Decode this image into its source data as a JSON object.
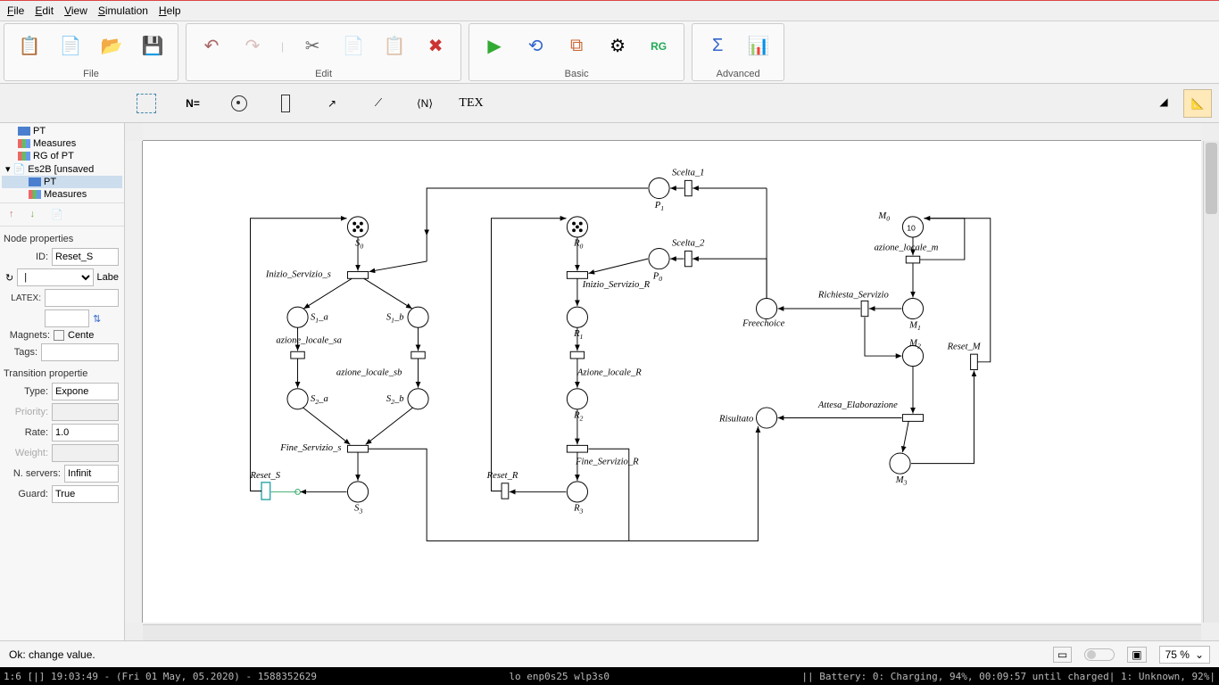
{
  "menubar": {
    "file": "File",
    "edit": "Edit",
    "view": "View",
    "simulation": "Simulation",
    "help": "Help"
  },
  "toolbar_groups": {
    "file": "File",
    "edit": "Edit",
    "basic": "Basic",
    "advanced": "Advanced"
  },
  "toolbar2": {
    "n_eq": "N=",
    "angle_n": "⟨N⟩",
    "tex": "TEX"
  },
  "tree": {
    "pt": "PT",
    "measures": "Measures",
    "rg_of_pt": "RG of PT",
    "es2b": "Es2B [unsaved",
    "sub_pt": "PT",
    "sub_measures": "Measures"
  },
  "props": {
    "node_props": "Node properties",
    "id_label": "ID:",
    "id_value": "Reset_S",
    "rot_value": "|",
    "label": "Labe",
    "latex_label": "LATEX:",
    "magnets_label": "Magnets:",
    "magnets_value": "Cente",
    "tags_label": "Tags:",
    "trans_props": "Transition propertie",
    "type_label": "Type:",
    "type_value": "Expone",
    "priority_label": "Priority:",
    "rate_label": "Rate:",
    "rate_value": "1.0",
    "weight_label": "Weight:",
    "servers_label": "N. servers:",
    "servers_value": "Infinit",
    "guard_label": "Guard:",
    "guard_value": "True"
  },
  "petri": {
    "scelta1": "Scelta_1",
    "p1": "P",
    "p1s": "1",
    "s0": "S",
    "s0s": "0",
    "r0": "R",
    "r0s": "0",
    "scelta2": "Scelta_2",
    "p0": "P",
    "p0s": "0",
    "m0": "M",
    "m0s": "0",
    "m0_tok": "10",
    "azione_locale_m": "azione_locale_m",
    "inizio_servizio_s": "Inizio_Servizio_s",
    "inizio_servizio_r": "Inizio_Servizio_R",
    "s1a": "S",
    "s1as": "1",
    "s1a2": "_a",
    "s1b": "S",
    "s1bs": "1",
    "s1b2": "_b",
    "azione_locale_sa": "azione_locale_sa",
    "azione_locale_sb": "azione_locale_sb",
    "r1": "R",
    "r1s": "1",
    "azione_locale_r": "Azione_locale_R",
    "s2a": "S",
    "s2as": "2",
    "s2a2": "_a",
    "s2b": "S",
    "s2bs": "2",
    "s2b2": "_b",
    "r2": "R",
    "r2s": "2",
    "fine_servizio_s": "Fine_Servizio_s",
    "fine_servizio_r": "Fine_Servizio_R",
    "s3": "S",
    "s3s": "3",
    "r3": "R",
    "r3s": "3",
    "reset_s": "Reset_S",
    "reset_r": "Reset_R",
    "freechoice": "Freechoice",
    "richiesta_servizio": "Richiesta_Servizio",
    "m1": "M",
    "m1s": "1",
    "m2": "M",
    "m2s": "2",
    "reset_m": "Reset_M",
    "risultato": "Risultato",
    "attesa": "Attesa_Elaborazione",
    "m3": "M",
    "m3s": "3"
  },
  "status": {
    "msg": "Ok: change value.",
    "zoom": "75 %"
  },
  "sysbar": {
    "left": "1:6 [|]    19:03:49 - (Fri 01 May, 05.2020) - 1588352629",
    "mid": "lo enp0s25 wlp3s0",
    "right": "||  Battery: 0: Charging, 94%, 00:09:57 until charged| 1: Unknown, 92%|"
  }
}
